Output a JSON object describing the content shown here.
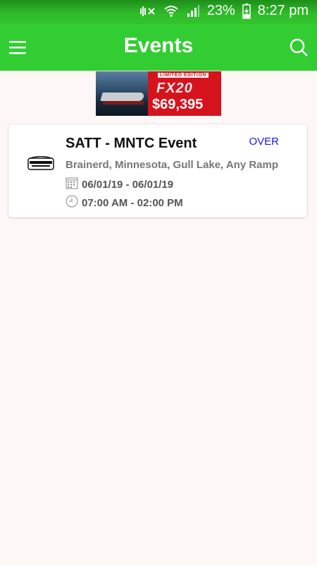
{
  "status_bar": {
    "battery": "23%",
    "time": "8:27 pm",
    "icons": [
      "mute-icon",
      "wifi-icon",
      "signal-icon",
      "battery-charging-icon"
    ]
  },
  "app_bar": {
    "title": "Events",
    "icons": [
      "menu-icon",
      "search-icon"
    ]
  },
  "ad_banner": {
    "ribbon": "LIMITED EDITION",
    "model": "FX20",
    "price": "$69,395"
  },
  "events": [
    {
      "name": "SATT - MNTC Event",
      "status": "OVER",
      "location": "Brainerd, Minnesota, Gull Lake, Any Ramp",
      "dates": "06/01/19 - 06/01/19",
      "times": "07:00 AM - 02:00 PM"
    }
  ],
  "colors": {
    "app_bar": "#32cd32",
    "status_over": "#1e18d6",
    "background": "#fdf8f6"
  }
}
